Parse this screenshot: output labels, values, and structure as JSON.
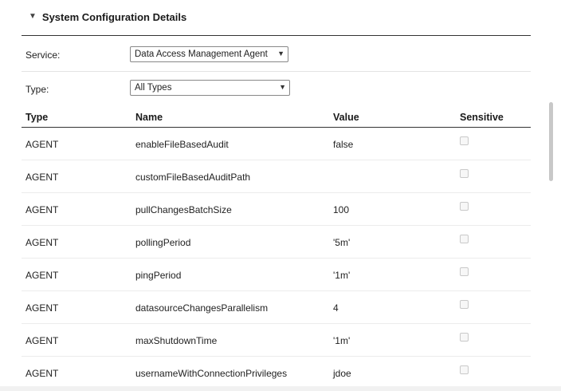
{
  "section": {
    "title": "System Configuration Details",
    "toggle_icon": "triangle-down-icon"
  },
  "filters": {
    "service_label": "Service:",
    "service_value": "Data Access Management Agent",
    "type_label": "Type:",
    "type_value": "All Types"
  },
  "table": {
    "columns": [
      "Type",
      "Name",
      "Value",
      "Sensitive"
    ],
    "rows": [
      {
        "type": "AGENT",
        "name": "enableFileBasedAudit",
        "value": "false",
        "sensitive": false
      },
      {
        "type": "AGENT",
        "name": "customFileBasedAuditPath",
        "value": "",
        "sensitive": false
      },
      {
        "type": "AGENT",
        "name": "pullChangesBatchSize",
        "value": "100",
        "sensitive": false
      },
      {
        "type": "AGENT",
        "name": "pollingPeriod",
        "value": "'5m'",
        "sensitive": false
      },
      {
        "type": "AGENT",
        "name": "pingPeriod",
        "value": "'1m'",
        "sensitive": false
      },
      {
        "type": "AGENT",
        "name": "datasourceChangesParallelism",
        "value": "4",
        "sensitive": false
      },
      {
        "type": "AGENT",
        "name": "maxShutdownTime",
        "value": "'1m'",
        "sensitive": false
      },
      {
        "type": "AGENT",
        "name": "usernameWithConnectionPrivileges",
        "value": "jdoe",
        "sensitive": false
      }
    ]
  }
}
